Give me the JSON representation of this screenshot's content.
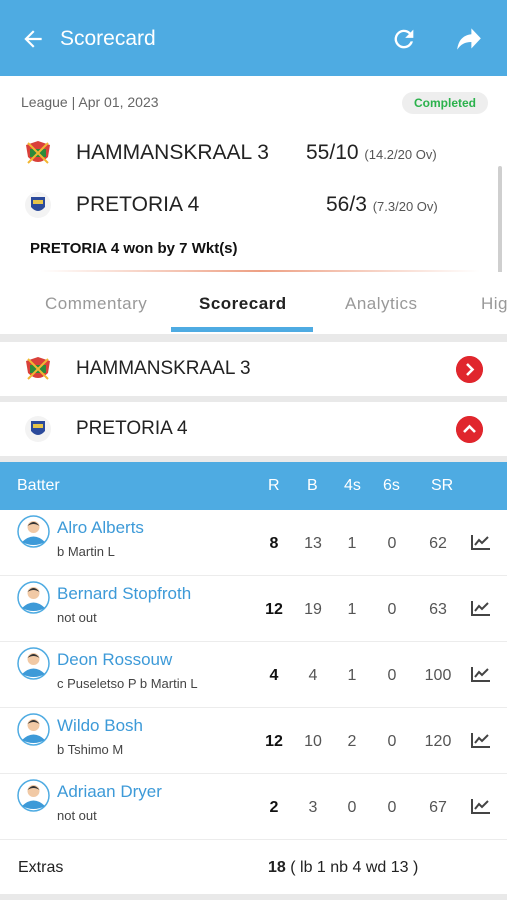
{
  "header": {
    "title": "Scorecard"
  },
  "match": {
    "meta": "League | Apr 01, 2023",
    "status": "Completed",
    "teams": [
      {
        "name": "HAMMANSKRAAL 3",
        "score": "55/10",
        "overs": "(14.2/20 Ov)"
      },
      {
        "name": "PRETORIA 4",
        "score": "56/3",
        "overs": "(7.3/20 Ov)"
      }
    ],
    "result": "PRETORIA 4 won by 7 Wkt(s)"
  },
  "tabs": [
    "Commentary",
    "Scorecard",
    "Analytics",
    "Hig"
  ],
  "active_tab": "Scorecard",
  "innings": [
    {
      "name": "HAMMANSKRAAL 3",
      "state": "collapsed"
    },
    {
      "name": "PRETORIA 4",
      "state": "expanded"
    }
  ],
  "batting_table": {
    "columns": [
      "Batter",
      "R",
      "B",
      "4s",
      "6s",
      "SR"
    ],
    "rows": [
      {
        "name": "Alro Alberts",
        "dismissal": "b Martin L",
        "r": "8",
        "b": "13",
        "fours": "1",
        "sixes": "0",
        "sr": "62"
      },
      {
        "name": "Bernard Stopfroth",
        "dismissal": "not out",
        "r": "12",
        "b": "19",
        "fours": "1",
        "sixes": "0",
        "sr": "63"
      },
      {
        "name": "Deon Rossouw",
        "dismissal": "c Puseletso P b Martin L",
        "r": "4",
        "b": "4",
        "fours": "1",
        "sixes": "0",
        "sr": "100"
      },
      {
        "name": "Wildo Bosh",
        "dismissal": "b Tshimo M",
        "r": "12",
        "b": "10",
        "fours": "2",
        "sixes": "0",
        "sr": "120"
      },
      {
        "name": "Adriaan Dryer",
        "dismissal": "not out",
        "r": "2",
        "b": "3",
        "fours": "0",
        "sixes": "0",
        "sr": "67"
      }
    ],
    "extras_label": "Extras",
    "extras_total": "18",
    "extras_detail": "( lb 1 nb 4 wd 13 )"
  },
  "colors": {
    "primary": "#4eabe2",
    "accent_red": "#e0262d",
    "completed_green": "#2bb24c",
    "link_blue": "#3d9ad8"
  },
  "icons": [
    "back-arrow-icon",
    "refresh-icon",
    "share-icon",
    "team-logo-icon",
    "chevron-right-icon",
    "chevron-up-icon",
    "player-avatar-icon",
    "trend-chart-icon"
  ]
}
